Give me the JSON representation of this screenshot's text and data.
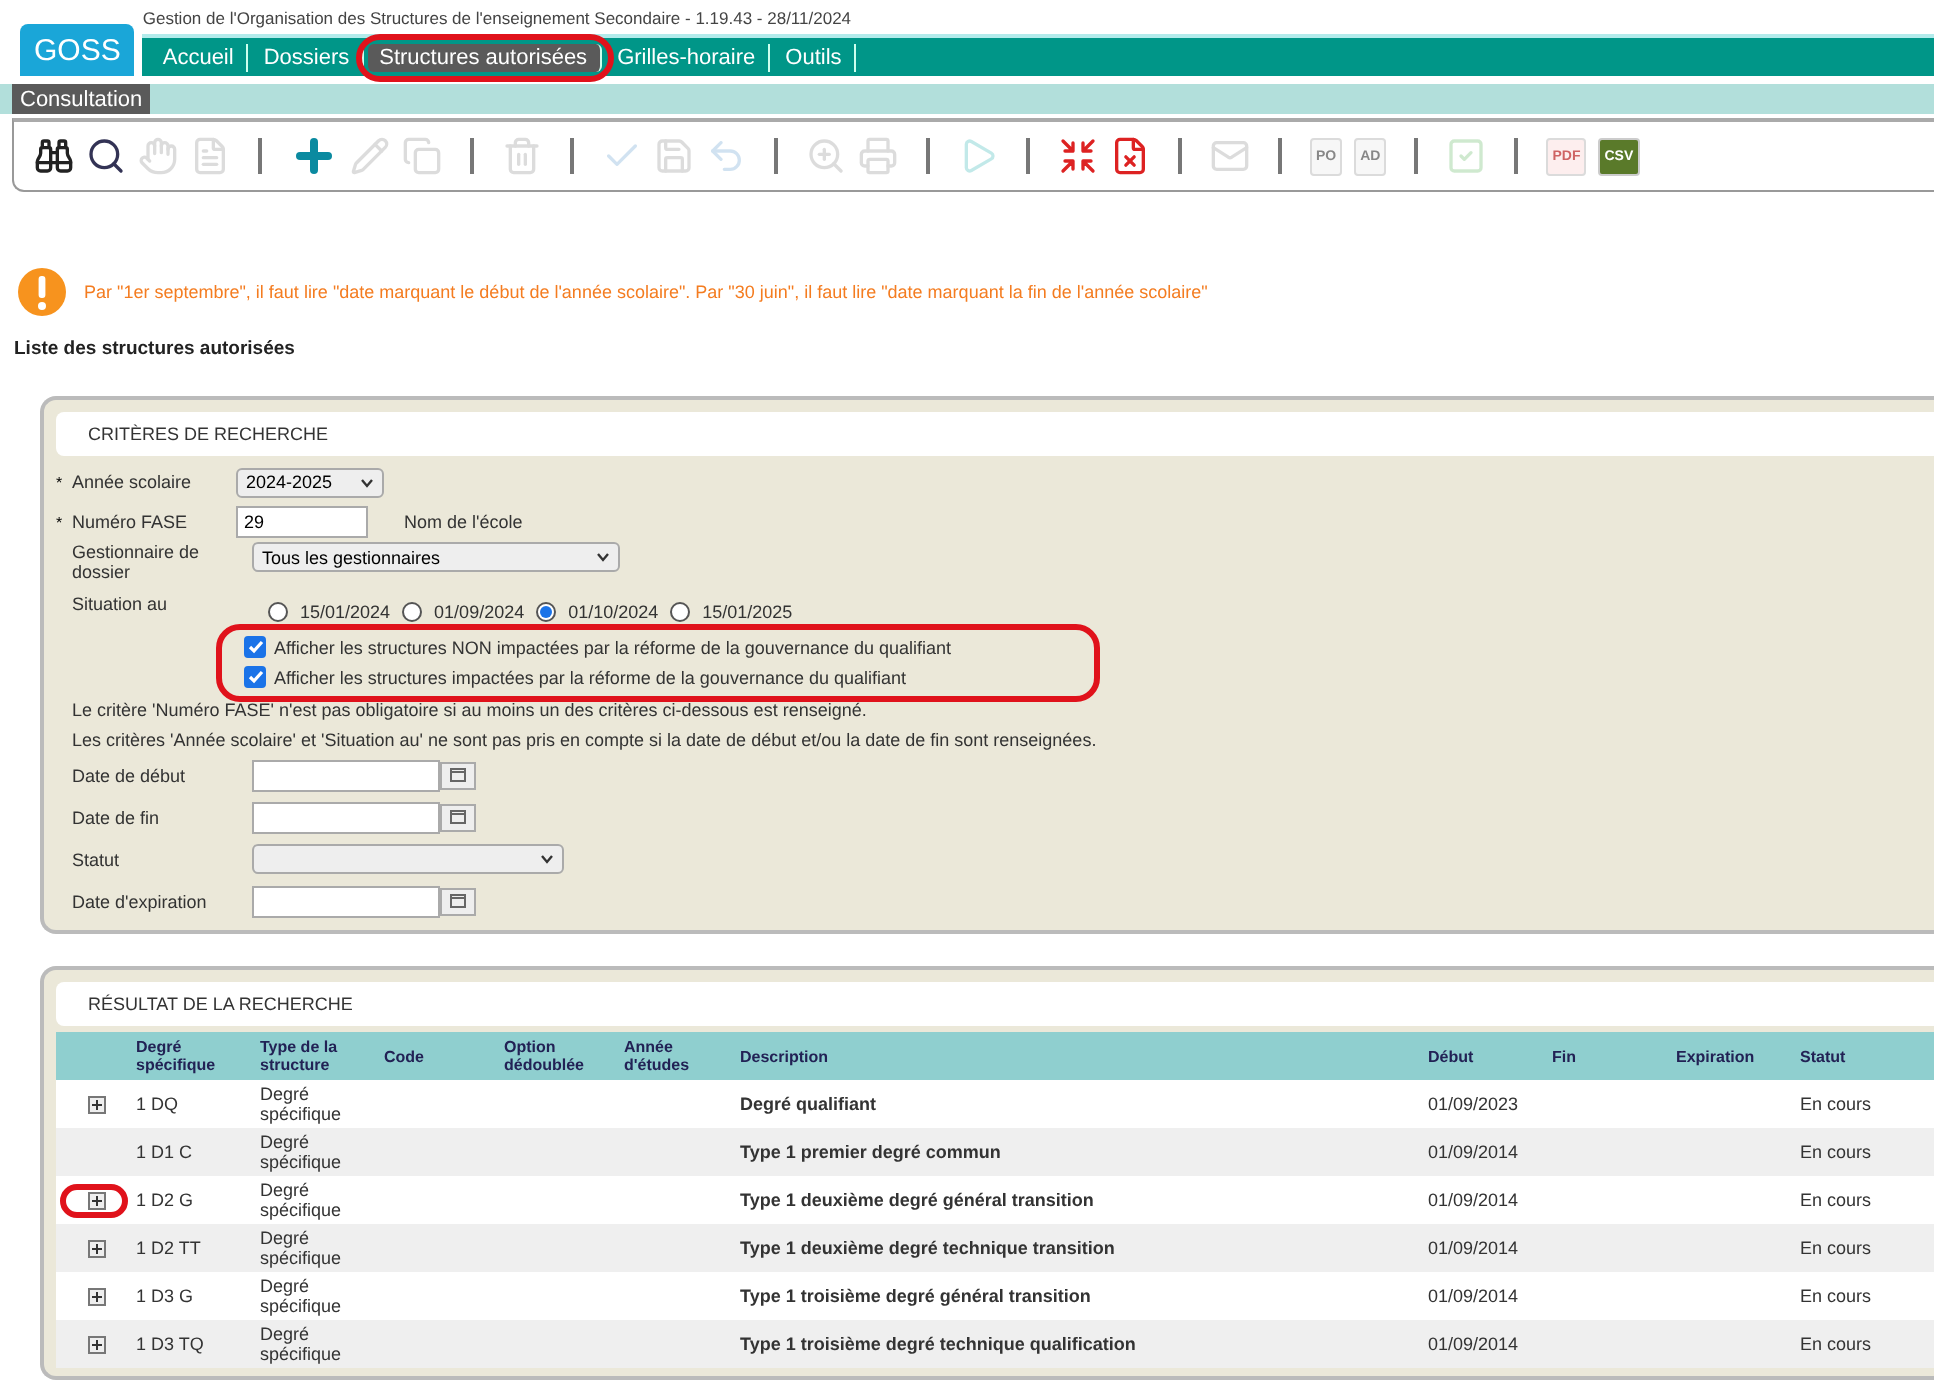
{
  "header": {
    "logo": "GOSS",
    "title": "Gestion de l'Organisation des Structures de l'enseignement Secondaire - 1.19.43 - 28/11/2024"
  },
  "tabs": [
    {
      "label": "Accueil",
      "selected": false,
      "annotated": false
    },
    {
      "label": "Dossiers",
      "selected": false,
      "annotated": false
    },
    {
      "label": "Structures autorisées",
      "selected": true,
      "annotated": true
    },
    {
      "label": "Grilles-horaire",
      "selected": false,
      "annotated": false
    },
    {
      "label": "Outils",
      "selected": false,
      "annotated": false
    }
  ],
  "subtabs": [
    {
      "label": "Consultation",
      "selected": true
    }
  ],
  "toolbar": [
    [
      {
        "disabled": false
      },
      {
        "disabled": false
      },
      {
        "disabled": true
      },
      {
        "disabled": true
      }
    ],
    [
      {
        "disabled": false
      },
      {
        "disabled": true
      },
      {
        "disabled": true
      }
    ],
    [
      {
        "disabled": true
      }
    ],
    [
      {
        "disabled": true
      },
      {
        "disabled": true
      },
      {
        "disabled": true
      }
    ],
    [
      {
        "disabled": true
      },
      {
        "disabled": true
      }
    ],
    [
      {
        "disabled": true
      }
    ],
    [
      {
        "disabled": false
      },
      {
        "disabled": false
      }
    ],
    [
      {
        "disabled": true
      }
    ],
    [
      {
        "disabled": true,
        "label": "PO"
      },
      {
        "disabled": true,
        "label": "AD"
      }
    ],
    [
      {
        "disabled": true
      }
    ],
    [
      {
        "disabled": true,
        "label": "PDF"
      },
      {
        "disabled": false,
        "label": "CSV"
      }
    ]
  ],
  "warning": "Par \"1er septembre\", il faut lire \"date marquant le début de l'année scolaire\". Par \"30 juin\", il faut lire \"date marquant la fin de l'année scolaire\"",
  "page_heading": "Liste des structures autorisées",
  "criteria": {
    "title": "CRITÈRES DE RECHERCHE",
    "school_year": {
      "label": "Année scolaire",
      "marker": "*",
      "value": "2024-2025"
    },
    "fase": {
      "label": "Numéro FASE",
      "marker": "*",
      "value": "29",
      "school_name_label": "Nom de l'école"
    },
    "manager": {
      "label": "Gestionnaire de dossier",
      "value": "Tous les gestionnaires"
    },
    "situation": {
      "label": "Situation au",
      "options": [
        {
          "label": "15/01/2024",
          "selected": false
        },
        {
          "label": "01/09/2024",
          "selected": false
        },
        {
          "label": "01/10/2024",
          "selected": true
        },
        {
          "label": "15/01/2025",
          "selected": false
        }
      ]
    },
    "checkboxes_annotated": true,
    "checkboxes": [
      {
        "label": "Afficher les structures NON impactées par la réforme de la gouvernance du qualifiant",
        "checked": true
      },
      {
        "label": "Afficher les structures impactées par la réforme de la gouvernance du qualifiant",
        "checked": true
      }
    ],
    "notes": [
      "Le critère 'Numéro FASE' n'est pas obligatoire si au moins un des critères ci-dessous est renseigné.",
      "Les critères 'Année scolaire' et 'Situation au' ne sont pas pris en compte si la date de début et/ou la date de fin sont renseignées."
    ],
    "fields": [
      {
        "label": "Date de début",
        "kind": "date"
      },
      {
        "label": "Date de fin",
        "kind": "date"
      },
      {
        "label": "Statut",
        "kind": "select"
      },
      {
        "label": "Date d'expiration",
        "kind": "date"
      }
    ]
  },
  "results": {
    "title": "RÉSULTAT DE LA RECHERCHE",
    "columns": [
      "Degré spécifique",
      "Type de la structure",
      "Code",
      "Option dédoublée",
      "Année d'études",
      "Description",
      "Début",
      "Fin",
      "Expiration",
      "Statut"
    ],
    "rows": [
      {
        "expandable": true,
        "annotated": false,
        "cells": [
          "1 DQ",
          "Degré spécifique",
          "",
          "",
          "",
          "Degré qualifiant",
          "01/09/2023",
          "",
          "",
          "En cours"
        ]
      },
      {
        "expandable": false,
        "annotated": false,
        "cells": [
          "1 D1 C",
          "Degré spécifique",
          "",
          "",
          "",
          "Type 1 premier degré commun",
          "01/09/2014",
          "",
          "",
          "En cours"
        ]
      },
      {
        "expandable": true,
        "annotated": true,
        "cells": [
          "1 D2 G",
          "Degré spécifique",
          "",
          "",
          "",
          "Type 1 deuxième degré général transition",
          "01/09/2014",
          "",
          "",
          "En cours"
        ]
      },
      {
        "expandable": true,
        "annotated": false,
        "cells": [
          "1 D2 TT",
          "Degré spécifique",
          "",
          "",
          "",
          "Type 1 deuxième degré technique transition",
          "01/09/2014",
          "",
          "",
          "En cours"
        ]
      },
      {
        "expandable": true,
        "annotated": false,
        "cells": [
          "1 D3 G",
          "Degré spécifique",
          "",
          "",
          "",
          "Type 1 troisième degré général transition",
          "01/09/2014",
          "",
          "",
          "En cours"
        ]
      },
      {
        "expandable": true,
        "annotated": false,
        "cells": [
          "1 D3 TQ",
          "Degré spécifique",
          "",
          "",
          "",
          "Type 1 troisième degré technique qualification",
          "01/09/2014",
          "",
          "",
          "En cours"
        ]
      }
    ]
  }
}
